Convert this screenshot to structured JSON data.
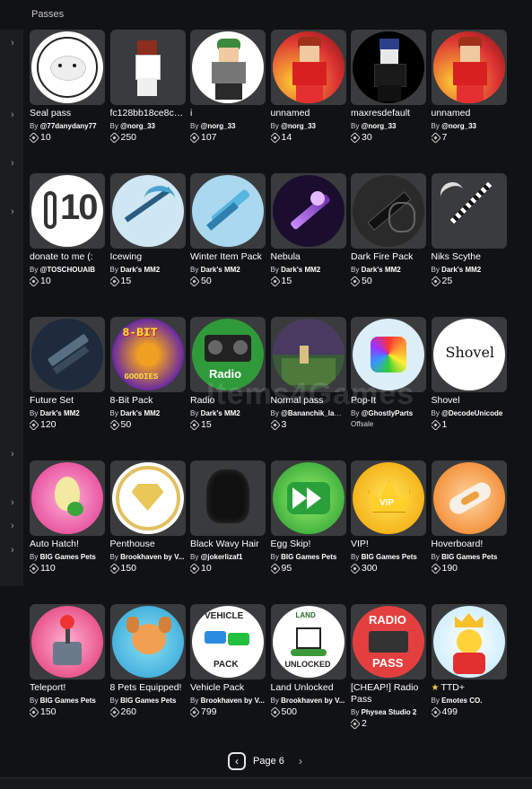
{
  "header": {
    "label": "Passes"
  },
  "watermark": "Items4Games",
  "colors": {
    "background": "#111214",
    "card_thumb": "#393b3d",
    "rail": "#1c1d20"
  },
  "rows": [
    [
      {
        "name": "Seal pass",
        "creator": "@77danydany77",
        "price": "10",
        "icon": "seal-icon"
      },
      {
        "name": "fc128bb18ce8c17...",
        "creator": "@norg_33",
        "price": "250",
        "icon": "avatar-figure-icon"
      },
      {
        "name": "i",
        "creator": "@norg_33",
        "price": "107",
        "icon": "avatar-green-hair-icon"
      },
      {
        "name": "unnamed",
        "creator": "@norg_33",
        "price": "14",
        "icon": "avatar-red-hair-icon"
      },
      {
        "name": "maxresdefault",
        "creator": "@norg_33",
        "price": "30",
        "icon": "avatar-dark-icon"
      },
      {
        "name": "unnamed",
        "creator": "@norg_33",
        "price": "7",
        "icon": "avatar-red-hair-icon"
      }
    ],
    [
      {
        "name": "donate to me (:",
        "creator": "@TOSCHOUAIB",
        "price": "10",
        "icon": "ten-badge-icon"
      },
      {
        "name": "Icewing",
        "creator": "Dark's MM2",
        "price": "15",
        "icon": "ice-scythe-icon"
      },
      {
        "name": "Winter Item Pack",
        "creator": "Dark's MM2",
        "price": "50",
        "icon": "ice-knife-icon"
      },
      {
        "name": "Nebula",
        "creator": "Dark's MM2",
        "price": "15",
        "icon": "nebula-knife-icon"
      },
      {
        "name": "Dark Fire Pack",
        "creator": "Dark's MM2",
        "price": "50",
        "icon": "dark-fire-icon"
      },
      {
        "name": "Niks Scythe",
        "creator": "Dark's MM2",
        "price": "25",
        "icon": "checker-scythe-icon"
      }
    ],
    [
      {
        "name": "Future Set",
        "creator": "Dark's MM2",
        "price": "120",
        "icon": "future-gun-icon"
      },
      {
        "name": "8-Bit Pack",
        "creator": "Dark's MM2",
        "price": "50",
        "icon": "eight-bit-icon",
        "art_text": "8-BIT",
        "art_text2": "GOODIES"
      },
      {
        "name": "Radio",
        "creator": "Dark's MM2",
        "price": "15",
        "icon": "radio-icon",
        "art_text": "Radio"
      },
      {
        "name": "Normal pass",
        "creator": "@Bananchik_lam...",
        "price": "3",
        "icon": "game-scene-icon"
      },
      {
        "name": "Pop-It",
        "creator": "@GhostlyParts",
        "price": "",
        "offsale": "Offsale",
        "icon": "pop-it-icon"
      },
      {
        "name": "Shovel",
        "creator": "@DecodeUnicode",
        "price": "1",
        "icon": "shovel-text-icon",
        "art_text": "Shovel"
      }
    ],
    [
      {
        "name": "Auto Hatch!",
        "creator": "BIG Games Pets",
        "price": "110",
        "icon": "egg-icon"
      },
      {
        "name": "Penthouse",
        "creator": "Brookhaven by V...",
        "price": "150",
        "icon": "diamond-icon"
      },
      {
        "name": "Black Wavy Hair",
        "creator": "@jokerlizaf1",
        "price": "10",
        "icon": "hair-icon"
      },
      {
        "name": "Egg Skip!",
        "creator": "BIG Games Pets",
        "price": "95",
        "icon": "fast-forward-icon"
      },
      {
        "name": "VIP!",
        "creator": "BIG Games Pets",
        "price": "300",
        "icon": "vip-crown-icon",
        "art_text": "VIP"
      },
      {
        "name": "Hoverboard!",
        "creator": "BIG Games Pets",
        "price": "190",
        "icon": "hoverboard-icon"
      }
    ],
    [
      {
        "name": "Teleport!",
        "creator": "BIG Games Pets",
        "price": "150",
        "icon": "joystick-icon"
      },
      {
        "name": "8 Pets Equipped!",
        "creator": "BIG Games Pets",
        "price": "260",
        "icon": "dog-icon"
      },
      {
        "name": "Vehicle Pack",
        "creator": "Brookhaven by V...",
        "price": "799",
        "icon": "vehicle-icon",
        "art_text": "VEHICLE",
        "art_text2": "PACK"
      },
      {
        "name": "Land Unlocked",
        "creator": "Brookhaven by V...",
        "price": "500",
        "icon": "house-icon",
        "art_text": "LAND",
        "art_text2": "UNLOCKED"
      },
      {
        "name": "[CHEAP!] Radio Pass",
        "creator": "Physea Studio 2",
        "price": "2",
        "icon": "radio-pass-icon",
        "art_text": "RADIO",
        "art_text2": "PASS"
      },
      {
        "name": "TTD+",
        "creator": "Emotes CO.",
        "price": "499",
        "icon": "crown-character-icon",
        "star": true
      }
    ]
  ],
  "by_label": "By",
  "pager": {
    "prev": "‹",
    "label": "Page 6",
    "next": "›"
  },
  "rail_chevrons": [
    "›",
    "›",
    "›",
    "›",
    "›",
    "›",
    "›",
    "›"
  ]
}
